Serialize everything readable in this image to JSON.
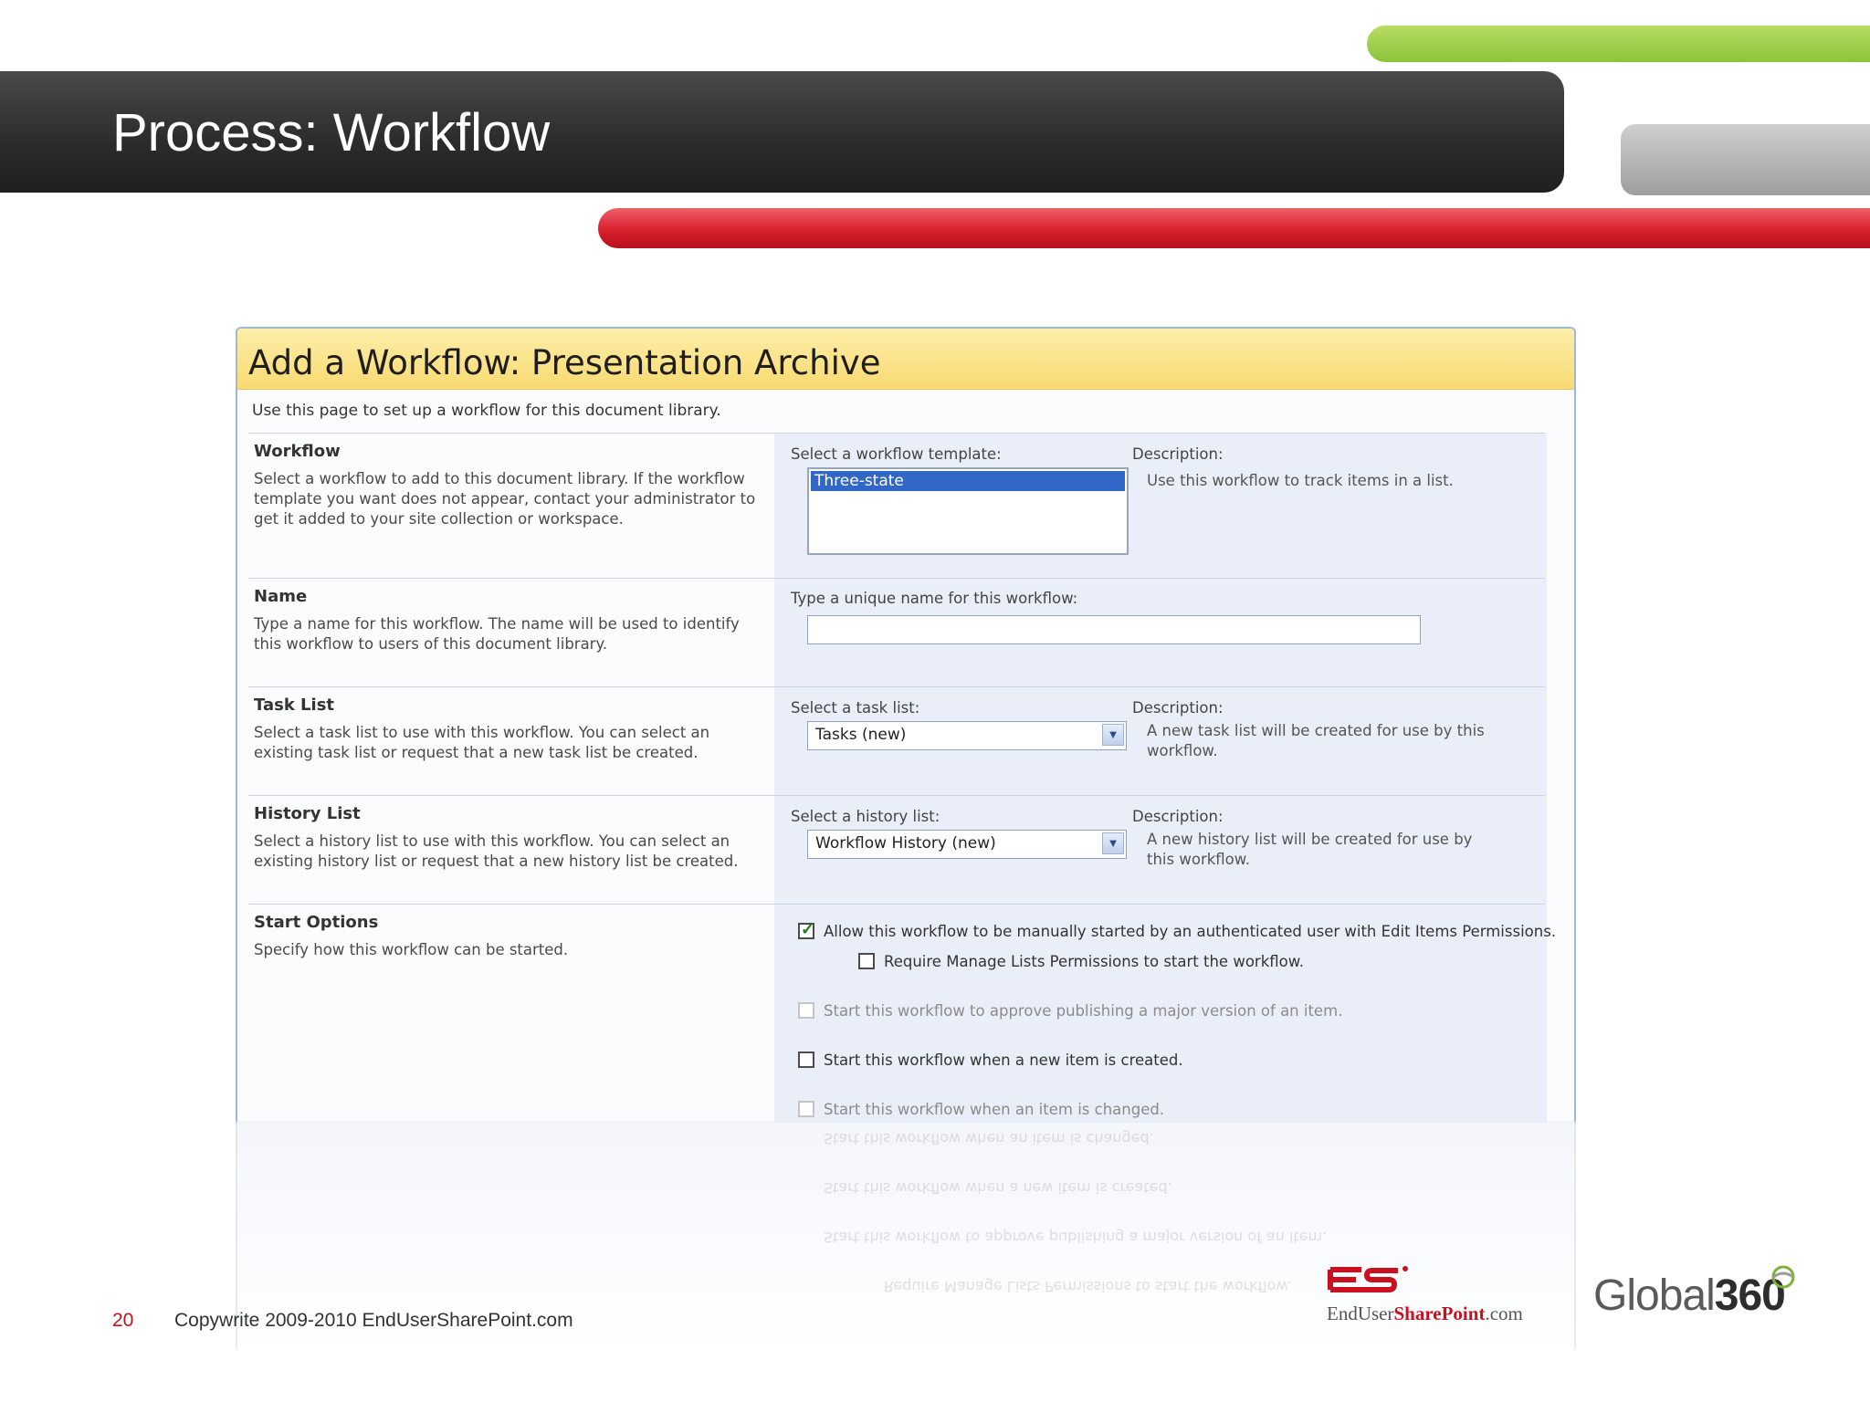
{
  "slide": {
    "title": "Process: Workflow",
    "page_number": "20",
    "copyright": "Copywrite 2009-2010 EndUserSharePoint.com"
  },
  "logos": {
    "es_mark": "ES",
    "es_name_part1": "EndUser",
    "es_name_part2": "SharePoint",
    "es_name_part3": ".com",
    "global_part1": "Global",
    "global_part2": "360"
  },
  "form": {
    "title": "Add a Workflow: Presentation Archive",
    "intro": "Use this page to set up a workflow for this document library.",
    "workflow": {
      "heading": "Workflow",
      "description": "Select a workflow to add to this document library. If the workflow template you want does not appear, contact your administrator to get it added to your site collection or workspace.",
      "template_label": "Select a workflow template:",
      "template_selected": "Three-state",
      "desc_label": "Description:",
      "desc_text": "Use this workflow to track items in a list."
    },
    "name": {
      "heading": "Name",
      "description": "Type a name for this workflow. The name will be used to identify this workflow to users of this document library.",
      "input_label": "Type a unique name for this workflow:",
      "input_value": ""
    },
    "task_list": {
      "heading": "Task List",
      "description": "Select a task list to use with this workflow. You can select an existing task list or request that a new task list be created.",
      "select_label": "Select a task list:",
      "selected": "Tasks (new)",
      "desc_label": "Description:",
      "desc_text": "A new task list will be created for use by this workflow."
    },
    "history_list": {
      "heading": "History List",
      "description": "Select a history list to use with this workflow. You can select an existing history list or request that a new history list be created.",
      "select_label": "Select a history list:",
      "selected": "Workflow History (new)",
      "desc_label": "Description:",
      "desc_text": "A new history list will be created for use by this workflow."
    },
    "start_options": {
      "heading": "Start Options",
      "description": "Specify how this workflow can be started.",
      "options": [
        {
          "label": "Allow this workflow to be manually started by an authenticated user with Edit Items Permissions.",
          "checked": true,
          "enabled": true
        },
        {
          "label": "Require Manage Lists Permissions to start the workflow.",
          "checked": false,
          "enabled": true
        },
        {
          "label": "Start this workflow to approve publishing a major version of an item.",
          "checked": false,
          "enabled": false
        },
        {
          "label": "Start this workflow when a new item is created.",
          "checked": false,
          "enabled": true
        },
        {
          "label": "Start this workflow when an item is changed.",
          "checked": false,
          "enabled": false
        }
      ]
    }
  },
  "colors": {
    "title_bar": "#2b2b2b",
    "green_bar": "#8cc43a",
    "red_bar": "#d81f2c",
    "form_header": "#f9da72",
    "selection": "#3167c6"
  }
}
